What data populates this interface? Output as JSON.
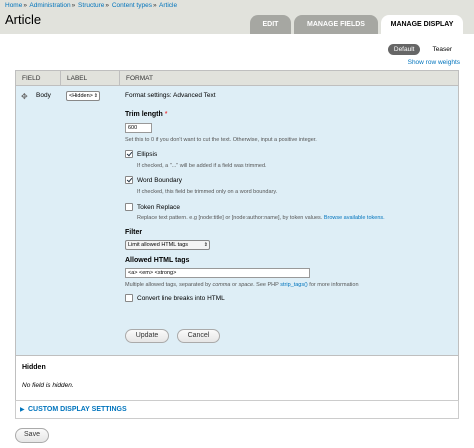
{
  "breadcrumb": [
    "Home",
    "Administration",
    "Structure",
    "Content types",
    "Article"
  ],
  "page_title": "Article",
  "tabs": {
    "edit": "EDIT",
    "manage_fields": "MANAGE FIELDS",
    "manage_display": "MANAGE DISPLAY"
  },
  "view_modes": {
    "default": "Default",
    "teaser": "Teaser"
  },
  "row_weights_link": "Show row weights",
  "table_headers": {
    "field": "FIELD",
    "label": "LABEL",
    "format": "FORMAT"
  },
  "field_row": {
    "name": "Body",
    "label_value": "<Hidden>",
    "format_settings_title": "Format settings: Advanced Text",
    "trim_length": {
      "label": "Trim length",
      "required_marker": "*",
      "value": "600",
      "description": "Set this to 0 if you don't want to cut the text. Otherwise, input a positive integer."
    },
    "ellipsis": {
      "label": "Ellipsis",
      "checked": true,
      "description": "If checked, a \"...\" will be added if a field was trimmed."
    },
    "word_boundary": {
      "label": "Word Boundary",
      "checked": true,
      "description": "If checked, this field be trimmed only on a word boundary."
    },
    "token_replace": {
      "label": "Token Replace",
      "checked": false,
      "description": "Replace text pattern. e.g [node:title] or [node:author:name], by token values.",
      "link": "Browse available tokens."
    },
    "filter": {
      "label": "Filter",
      "value": "Limit allowed HTML tags"
    },
    "allowed_tags": {
      "label": "Allowed HTML tags",
      "value": "<a> <em> <strong>",
      "description_pre": "Multiple allowed tags, separated by",
      "description_comma": "comma",
      "description_or": "or",
      "description_space": "space",
      "description_mid": ". See PHP",
      "description_link": "strip_tags()",
      "description_post": "for more information"
    },
    "line_breaks": {
      "label": "Convert line breaks into HTML",
      "checked": false
    },
    "update_button": "Update",
    "cancel_button": "Cancel"
  },
  "hidden_section": {
    "title": "Hidden",
    "empty_text": "No field is hidden."
  },
  "custom_display": "CUSTOM DISPLAY SETTINGS",
  "save_button": "Save",
  "colors": {
    "link": "#0074bd",
    "header_bg": "#e1e2dc",
    "row_bg": "#deeef6"
  }
}
